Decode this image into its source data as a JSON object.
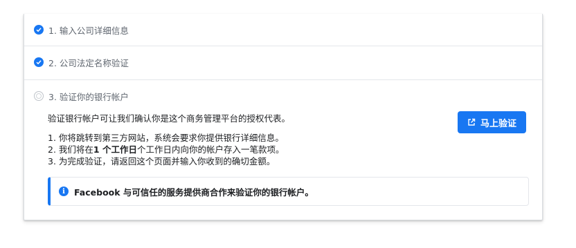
{
  "steps": [
    {
      "label": "1. 输入公司详细信息",
      "status": "done"
    },
    {
      "label": "2. 公司法定名称验证",
      "status": "done"
    },
    {
      "label": "3. 验证你的银行帐户",
      "status": "pending"
    }
  ],
  "step3": {
    "intro": "验证银行帐户可让我们确认你是这个商务管理平台的授权代表。",
    "verify_button": "马上验证",
    "list_line1": "1. 你将跳转到第三方网站，系统会要求你提供银行详细信息。",
    "list_line2_prefix": "2. 我们将在",
    "list_line2_bold": "1 个工作日",
    "list_line2_suffix": "个工作日内向你的帐户存入一笔款项。",
    "list_line3": "3. 为完成验证，请返回这个页面并输入你收到的确切金额。",
    "notice": "Facebook 与可信任的服务提供商合作来验证你的银行帐户。"
  },
  "colors": {
    "accent": "#1877f2",
    "text": "#1c1e21",
    "muted": "#606770",
    "border": "#dadde1"
  },
  "icons": {
    "done": "checkmark-circle-icon",
    "pending": "empty-radio-icon",
    "button": "external-link-icon",
    "notice": "info-icon"
  }
}
